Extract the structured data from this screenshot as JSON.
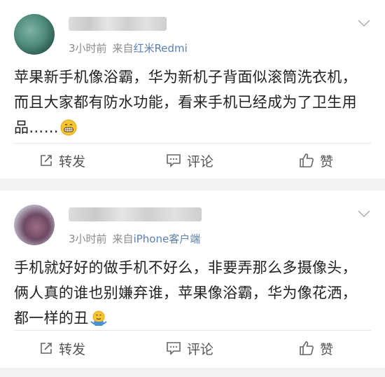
{
  "posts": [
    {
      "time": "3小时前",
      "source_prefix": "来自",
      "source": "红米Redmi",
      "text": "苹果新手机像浴霸，华为新机子背面似滚筒洗衣机，而且大家都有防水功能，看来手机已经成为了卫生用品……",
      "emoji": "grinning-face-emoji",
      "actions": {
        "repost": "转发",
        "comment": "评论",
        "like": "赞"
      }
    },
    {
      "time": "3小时前",
      "source_prefix": "来自",
      "source": "iPhone客户端",
      "text": "手机就好好的做手机不好么，非要弄那么多摄像头，俩人真的谁也别嫌弃谁，苹果像浴霸，华为像花洒，都一样的丑",
      "emoji": "shrug-face-emoji",
      "actions": {
        "repost": "转发",
        "comment": "评论",
        "like": "赞"
      }
    }
  ],
  "colors": {
    "source_link": "#5b7fb3",
    "meta_gray": "#8c8c8c",
    "background": "#f2f2f2"
  }
}
